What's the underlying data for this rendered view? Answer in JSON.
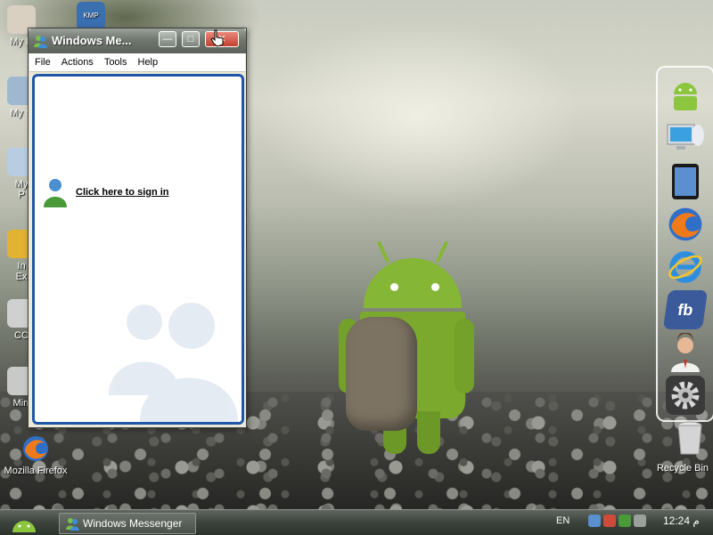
{
  "desktop": {
    "icons": [
      {
        "label": "My D"
      },
      {
        "label": "My C"
      },
      {
        "label": "My\nP"
      },
      {
        "label": "In\nEx"
      },
      {
        "label": "CC"
      },
      {
        "label": "Mirr"
      },
      {
        "label": "Mozilla Firefox"
      },
      {
        "label": "Recycle Bin"
      }
    ],
    "kmp_label": "KMP"
  },
  "dock": {
    "items": [
      {
        "icon": "android-icon"
      },
      {
        "icon": "computer-icon"
      },
      {
        "icon": "tablet-icon"
      },
      {
        "icon": "firefox-icon"
      },
      {
        "icon": "internet-explorer-icon"
      },
      {
        "icon": "facebook-icon",
        "text": "fb"
      },
      {
        "icon": "support-agent-icon"
      },
      {
        "icon": "gear-icon"
      },
      {
        "icon": "recycle-bin-icon"
      }
    ]
  },
  "window": {
    "title": "Windows Me...",
    "menu": [
      "File",
      "Actions",
      "Tools",
      "Help"
    ],
    "signin_link": "Click here to sign in",
    "minimize_symbol": "—",
    "maximize_symbol": "□",
    "close_symbol": "✕"
  },
  "taskbar": {
    "task_label": "Windows Messenger",
    "language": "EN",
    "clock": "12:24 م"
  },
  "colors": {
    "window_border_blue": "#1f56a8",
    "titlebar": "#6f776f",
    "taskbar": "#3c433c",
    "android_green": "#85b636"
  }
}
